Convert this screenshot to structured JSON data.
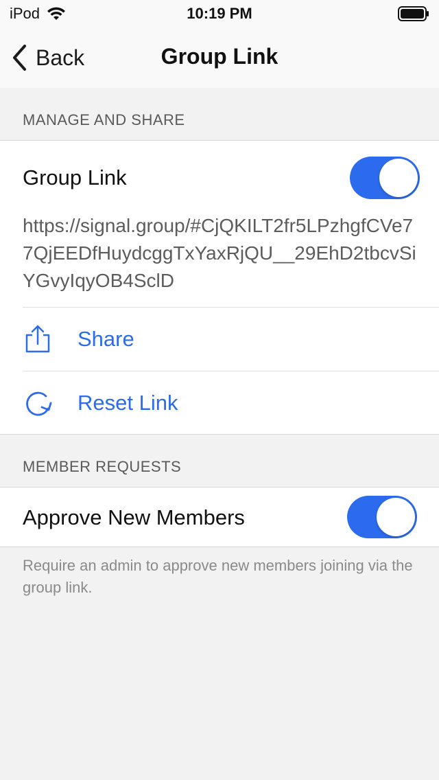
{
  "status_bar": {
    "carrier": "iPod",
    "time": "10:19 PM",
    "icons": [
      "wifi-icon",
      "battery-icon"
    ]
  },
  "nav": {
    "back_label": "Back",
    "title": "Group Link"
  },
  "manage_section": {
    "header": "MANAGE AND SHARE",
    "group_link_label": "Group Link",
    "group_link_enabled": true,
    "link_url": "https://signal.group/#CjQKILT2fr5LPzhgfCVe77QjEEDfHuydcggTxYaxRjQU__29EhD2tbcvSiYGvyIqyOB4SclD",
    "actions": [
      {
        "label": "Share",
        "icon": "share-icon"
      },
      {
        "label": "Reset Link",
        "icon": "reset-icon"
      }
    ]
  },
  "member_section": {
    "header": "MEMBER REQUESTS",
    "approve_label": "Approve New Members",
    "approve_enabled": true,
    "footer": "Require an admin to approve new members joining via the group link."
  },
  "colors": {
    "accent": "#2c6bed",
    "background": "#f2f2f2",
    "cell": "#ffffff"
  }
}
